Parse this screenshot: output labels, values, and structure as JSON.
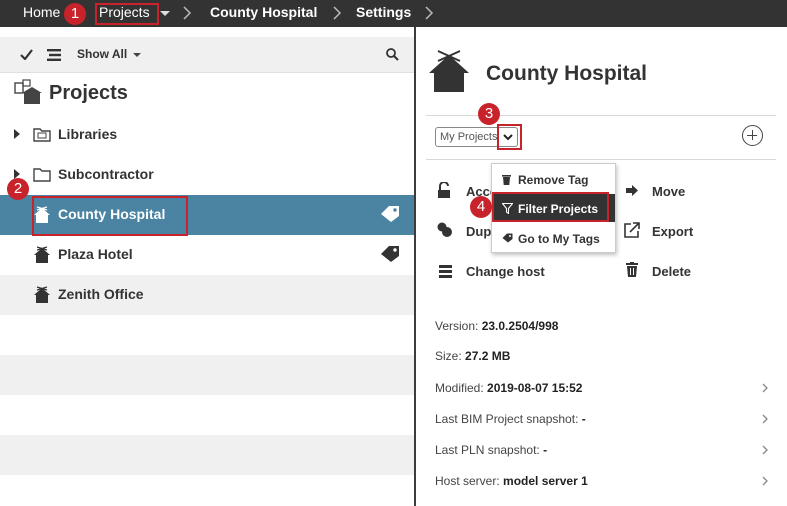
{
  "breadcrumb": {
    "home": "Home",
    "projects": "Projects",
    "project": "County Hospital",
    "settings": "Settings"
  },
  "annotations": [
    "1",
    "2",
    "3",
    "4"
  ],
  "left_panel": {
    "toolbar": {
      "show_all": "Show All"
    },
    "title": "Projects",
    "items": [
      {
        "label": "Libraries",
        "icon": "library-folder-icon"
      },
      {
        "label": "Subcontractor",
        "icon": "folder-icon"
      },
      {
        "label": "County Hospital",
        "icon": "house-icon"
      },
      {
        "label": "Plaza Hotel",
        "icon": "house-icon"
      },
      {
        "label": "Zenith Office",
        "icon": "house-icon"
      }
    ]
  },
  "right_panel": {
    "title": "County Hospital",
    "tag_select": {
      "value": "My Projects"
    },
    "actions": {
      "access": "Acce",
      "move": "Move",
      "duplicate": "Dupl",
      "export": "Export",
      "change_host": "Change host",
      "delete": "Delete"
    },
    "info": {
      "version_label": "Version:",
      "version": "23.0.2504/998",
      "size_label": "Size:",
      "size": "27.2 MB",
      "modified_label": "Modified:",
      "modified": "2019-08-07 15:52",
      "bim_label": "Last BIM Project snapshot:",
      "bim": "-",
      "pln_label": "Last PLN snapshot:",
      "pln": "-",
      "host_label": "Host server:",
      "host": "model server 1"
    }
  },
  "tag_menu": {
    "remove_tag": "Remove Tag",
    "filter_projects": "Filter Projects",
    "go_to_tags": "Go to My Tags"
  },
  "colors": {
    "topbar": "#333333",
    "selected_row": "#4a84a2",
    "annotation": "#c8232b"
  }
}
